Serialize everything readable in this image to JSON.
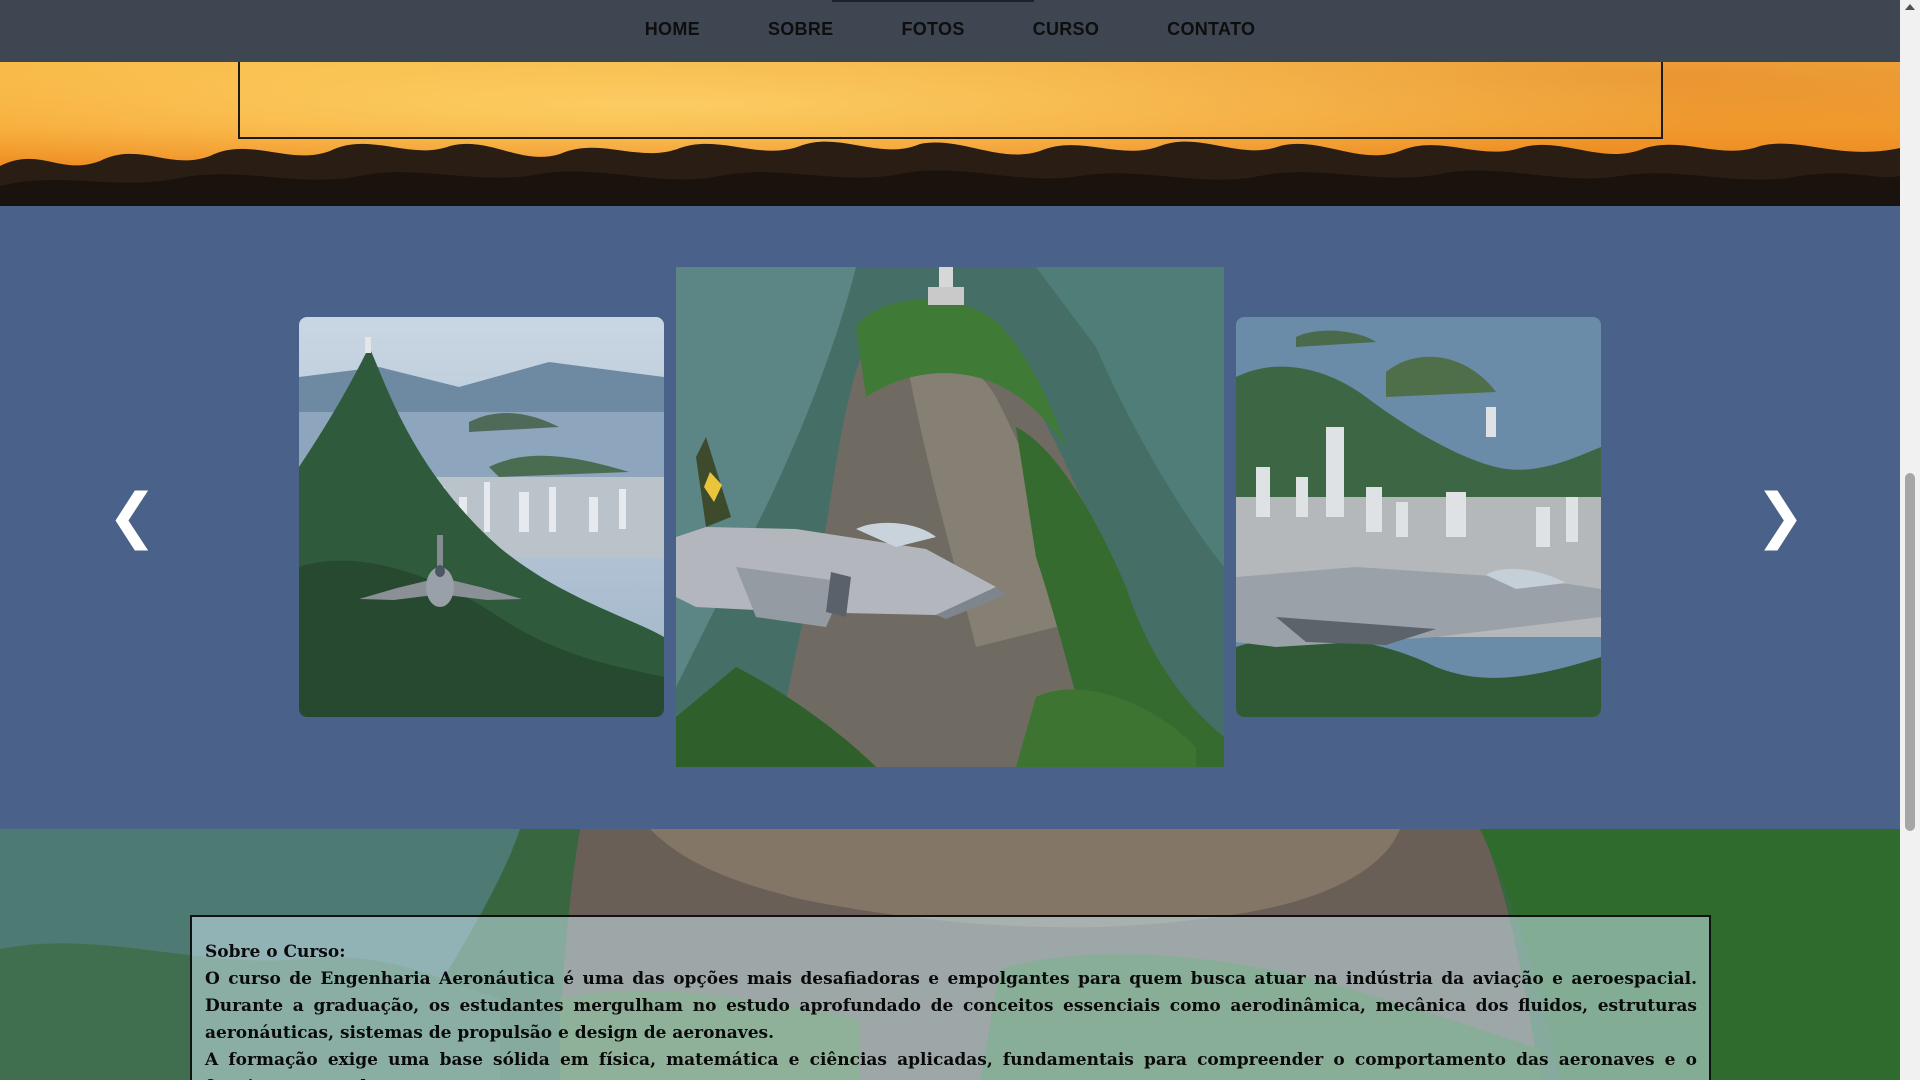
{
  "nav": {
    "items": [
      {
        "label": "HOME"
      },
      {
        "label": "SOBRE"
      },
      {
        "label": "FOTOS"
      },
      {
        "label": "CURSO"
      },
      {
        "label": "CONTATO"
      }
    ],
    "active_index": 2
  },
  "carousel": {
    "prev_label": "❮",
    "next_label": "❯",
    "slides": [
      {
        "icon": "jet-over-rio-bay-photo"
      },
      {
        "icon": "jet-over-corcovado-photo"
      },
      {
        "icon": "jet-over-rio-city-photo"
      }
    ]
  },
  "course": {
    "title": "Sobre o Curso:",
    "paragraph_1": "O curso de Engenharia Aeronáutica é uma das opções mais desafiadoras e empolgantes para quem busca atuar na indústria da aviação e aeroespacial. Durante a graduação, os estudantes mergulham no estudo aprofundado de conceitos essenciais como aerodinâmica, mecânica dos fluidos, estruturas aeronáuticas, sistemas de propulsão e design de aeronaves.",
    "paragraph_2": "A formação exige uma base sólida em física, matemática e ciências aplicadas, fundamentais para compreender o comportamento das aeronaves e o funcionamento dos"
  },
  "colors": {
    "nav_bg": "#3e4652",
    "carousel_bg": "#4a6189",
    "sunset": "#f6a32e"
  }
}
